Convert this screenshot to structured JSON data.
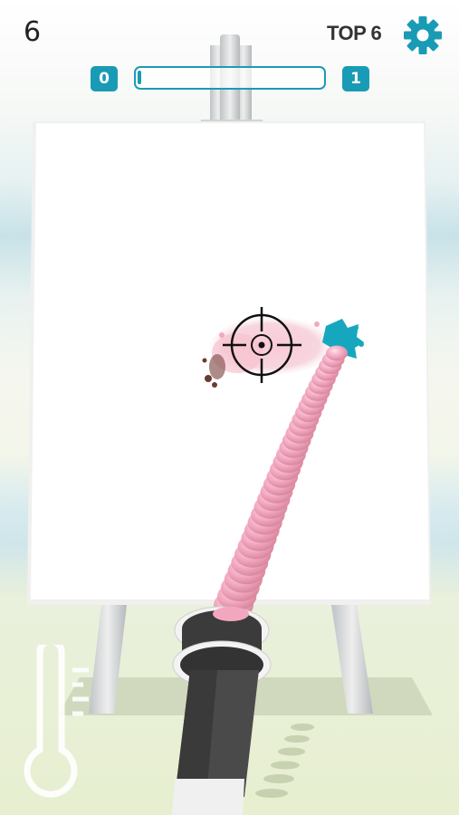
{
  "hud": {
    "level": "6",
    "rank_label": "TOP 6",
    "progress": {
      "from_level": "0",
      "to_level": "1",
      "fraction": 0.02
    },
    "settings_icon": "gear-icon"
  },
  "colors": {
    "accent": "#1a9bb5",
    "paint_pink": "#f2a6bf",
    "paint_cyan": "#16a7bf",
    "canvas": "#ffffff",
    "easel": "#d9d9d9"
  },
  "scene": {
    "crosshair_icon": "crosshair-icon",
    "thermometer_icon": "thermometer-icon",
    "paint_gun_icon": "paint-gun-icon"
  }
}
